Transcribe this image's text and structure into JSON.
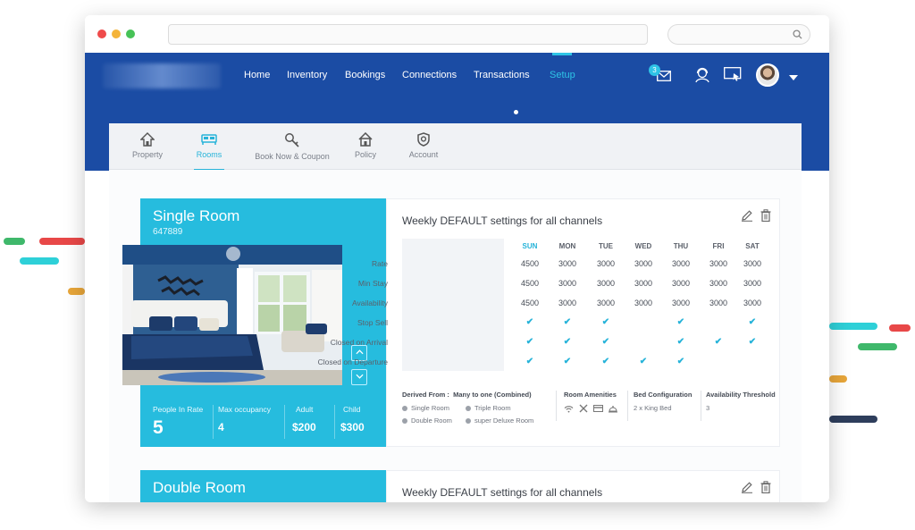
{
  "nav": {
    "items": [
      "Home",
      "Inventory",
      "Bookings",
      "Connections",
      "Transactions",
      "Setup"
    ],
    "active": "Setup",
    "mail_badge": "3",
    "icons": [
      "mail-icon",
      "support-icon",
      "screen-icon",
      "avatar",
      "chevron-down-icon"
    ]
  },
  "tabs": [
    {
      "label": "Property",
      "icon": "property-icon"
    },
    {
      "label": "Rooms",
      "icon": "bed-icon"
    },
    {
      "label": "Book Now & Coupon",
      "icon": "key-icon"
    },
    {
      "label": "Policy",
      "icon": "house-icon"
    },
    {
      "label": "Account",
      "icon": "shield-icon"
    }
  ],
  "colors": {
    "nav": "#1b4ca4",
    "accent": "#26bcde",
    "active_text": "#26b3d9"
  },
  "rooms": [
    {
      "name": "Single Room",
      "code": "647889",
      "stats": {
        "people_label": "People In Rate",
        "people_value": "5",
        "max_label": "Max occupancy",
        "max_value": "4",
        "adult_label": "Adult",
        "adult_value": "$200",
        "child_label": "Child",
        "child_value": "$300"
      },
      "settings_title": "Weekly DEFAULT settings for all channels",
      "days": [
        "SUN",
        "MON",
        "TUE",
        "WED",
        "THU",
        "FRI",
        "SAT"
      ],
      "rows": [
        {
          "label": "Rate",
          "values": [
            "4500",
            "3000",
            "3000",
            "3000",
            "3000",
            "3000",
            "3000"
          ]
        },
        {
          "label": "Min Stay",
          "values": [
            "4500",
            "3000",
            "3000",
            "3000",
            "3000",
            "3000",
            "3000"
          ]
        },
        {
          "label": "Availability",
          "values": [
            "4500",
            "3000",
            "3000",
            "3000",
            "3000",
            "3000",
            "3000"
          ]
        }
      ],
      "check_rows": [
        {
          "label": "Stop Sell",
          "checks": [
            true,
            true,
            true,
            false,
            true,
            false,
            true
          ]
        },
        {
          "label": "Closed on Arrival",
          "checks": [
            true,
            true,
            true,
            false,
            true,
            true,
            true
          ]
        },
        {
          "label": "Closed on Departure",
          "checks": [
            true,
            true,
            true,
            true,
            true,
            false,
            false
          ]
        }
      ],
      "footer": {
        "derived_label": "Derived From :",
        "derived_value": "Many to one (Combined)",
        "derived_items": [
          "Single Room",
          "Triple Room",
          "Double Room",
          "super Deluxe Room"
        ],
        "amenities_label": "Room Amenities",
        "amenity_icons": [
          "wifi-icon",
          "restaurant-icon",
          "card-icon",
          "room-service-icon"
        ],
        "bed_label": "Bed Configuration",
        "bed_value": "2 x King Bed",
        "threshold_label": "Availability Threshold",
        "threshold_value": "3"
      }
    },
    {
      "name": "Double Room",
      "settings_title": "Weekly DEFAULT settings for all channels"
    }
  ]
}
